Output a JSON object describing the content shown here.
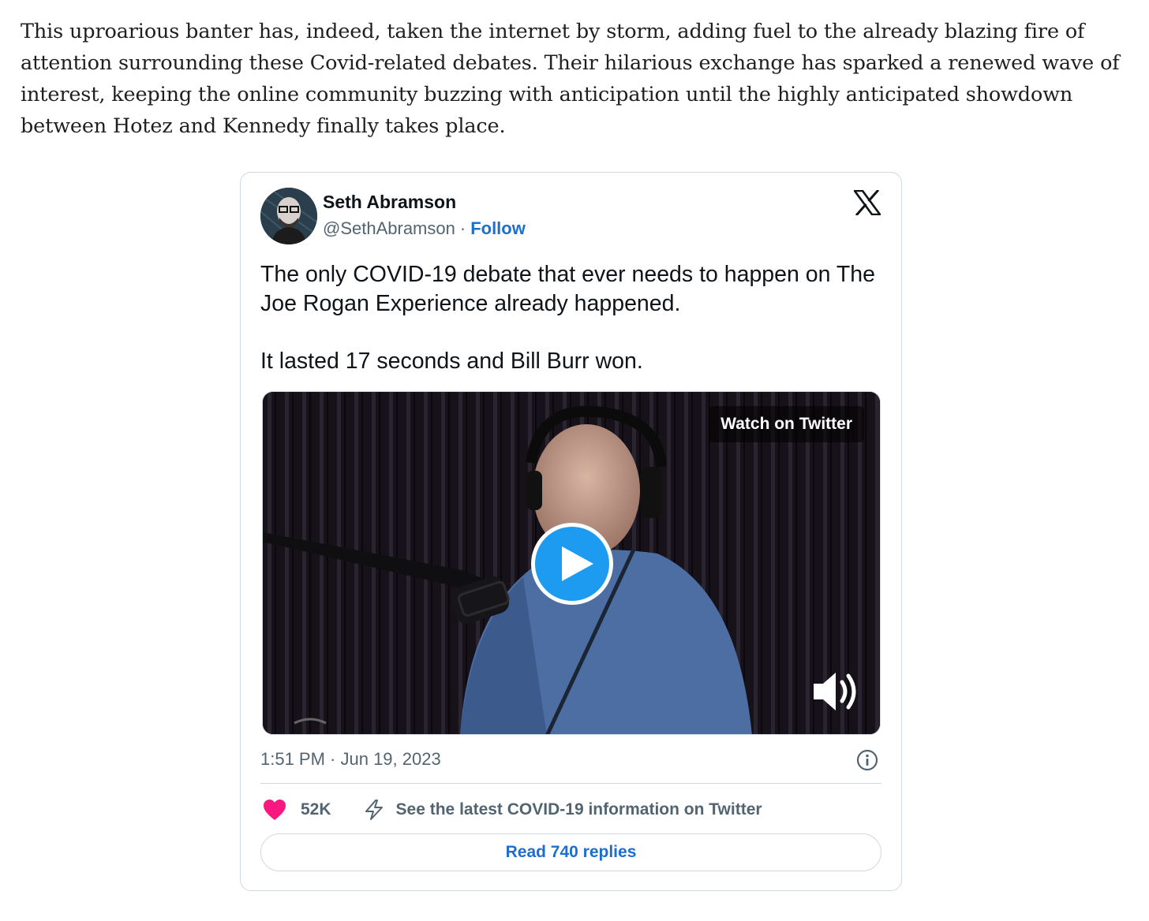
{
  "article": {
    "paragraph": "This uproarious banter has, indeed, taken the internet by storm, adding fuel to the already blazing fire of attention surrounding these Covid-related debates. Their hilarious exchange has sparked a renewed wave of interest, keeping the online community buzzing with anticipation until the highly anticipated showdown between Hotez and Kennedy finally takes place."
  },
  "tweet": {
    "author_name": "Seth Abramson",
    "handle": "@SethAbramson",
    "separator": "·",
    "follow_label": "Follow",
    "text_line_1": "The only COVID-19 debate that ever needs to happen on The Joe Rogan Experience already happened.",
    "text_line_2": "It lasted 17 seconds and Bill Burr won.",
    "video": {
      "watch_label": "Watch on Twitter",
      "play_icon": "play-icon",
      "volume_icon": "volume-icon"
    },
    "timestamp": "1:51 PM · Jun 19, 2023",
    "likes": "52K",
    "covid_info": "See the latest COVID-19 information on Twitter",
    "replies_label": "Read 740 replies",
    "icons": {
      "brand": "x-logo-icon",
      "info": "info-icon",
      "like": "heart-icon",
      "covid": "lightning-bolt-icon"
    },
    "colors": {
      "accent": "#1d6ecf",
      "play": "#1d9bf0",
      "heart": "#f91880",
      "muted": "#536471",
      "border": "#cfd9de"
    }
  }
}
